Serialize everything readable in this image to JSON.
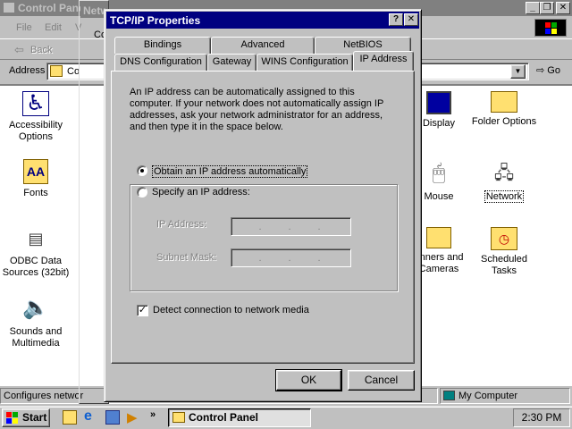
{
  "control_panel": {
    "title": "Control Panel",
    "menu": [
      "File",
      "Edit",
      "V"
    ],
    "back_label": "Back",
    "address_label": "Address",
    "address_value": "Co",
    "go_label": "Go",
    "items": [
      {
        "label": "Accessibility Options",
        "icon": "accessibility-icon"
      },
      {
        "label": "Fonts",
        "icon": "fonts-icon"
      },
      {
        "label": "ODBC Data Sources (32bit)",
        "icon": "odbc-icon"
      },
      {
        "label": "Sounds and Multimedia",
        "icon": "sounds-icon"
      },
      {
        "label": "Display",
        "icon": "display-icon"
      },
      {
        "label": "Folder Options",
        "icon": "folder-options-icon"
      },
      {
        "label": "Mouse",
        "icon": "mouse-icon"
      },
      {
        "label": "Network",
        "icon": "network-icon"
      },
      {
        "label": "anners and Cameras",
        "icon": "scanners-cameras-icon"
      },
      {
        "label": "Scheduled Tasks",
        "icon": "scheduled-tasks-icon"
      }
    ],
    "status_left": "Configures networ",
    "status_right": "My Computer"
  },
  "network_dialog": {
    "title": "Network",
    "tab_fragment": "Co"
  },
  "tcpip_dialog": {
    "title": "TCP/IP Properties",
    "help_glyph": "?",
    "close_glyph": "✕",
    "tabs_row1": [
      "Bindings",
      "Advanced",
      "NetBIOS"
    ],
    "tabs_row2": [
      "DNS Configuration",
      "Gateway",
      "WINS Configuration",
      "IP Address"
    ],
    "active_tab": "IP Address",
    "description": "An IP address can be automatically assigned to this computer. If your network does not automatically assign IP addresses, ask your network administrator for an address, and then type it in the space below.",
    "radio_auto": "Obtain an IP address automatically",
    "radio_specify": "Specify an IP address:",
    "ip_address_label": "IP Address:",
    "subnet_mask_label": "Subnet Mask:",
    "checkbox_detect": "Detect connection to network media",
    "ok_label": "OK",
    "cancel_label": "Cancel"
  },
  "taskbar": {
    "start_label": "Start",
    "task_label": "Control Panel",
    "clock": "2:30 PM",
    "chevron": "»"
  }
}
